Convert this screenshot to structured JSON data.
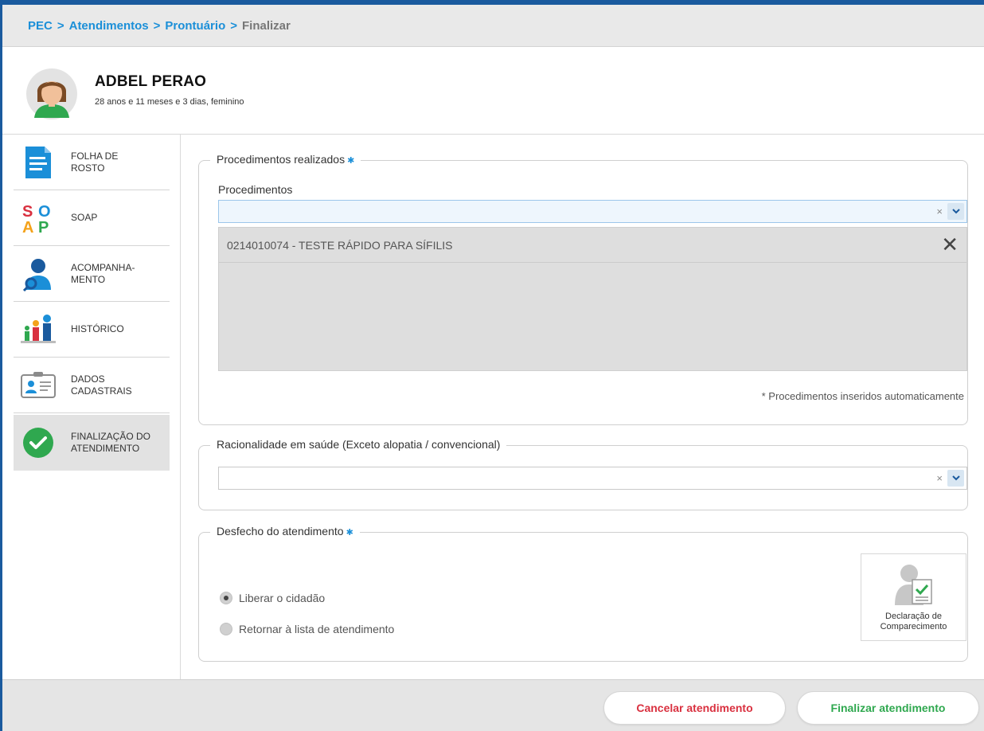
{
  "colors": {
    "brand_blue": "#1a5a9e",
    "link_blue": "#1b8fd8",
    "success_green": "#2fa84f",
    "danger_red": "#d9303f"
  },
  "breadcrumb": {
    "items": [
      "PEC",
      "Atendimentos",
      "Prontuário"
    ],
    "separator": ">",
    "current": "Finalizar"
  },
  "patient": {
    "name": "ADBEL PERAO",
    "info": "28 anos e 11 meses e 3 dias, feminino",
    "avatar_icon": "female-avatar-icon"
  },
  "sidebar": {
    "items": [
      {
        "label": "FOLHA DE\nROSTO",
        "icon": "document-icon"
      },
      {
        "label": "SOAP",
        "icon": "soap-icon",
        "icon_letters": [
          "S",
          "O",
          "A",
          "P"
        ]
      },
      {
        "label": "ACOMPANHA-\nMENTO",
        "icon": "user-search-icon"
      },
      {
        "label": "HISTÓRICO",
        "icon": "family-history-icon"
      },
      {
        "label": "DADOS\nCADASTRAIS",
        "icon": "id-card-icon"
      },
      {
        "label": "FINALIZAÇÃO DO\nATENDIMENTO",
        "icon": "check-circle-icon",
        "active": true
      }
    ]
  },
  "procedimentos": {
    "legend": "Procedimentos realizados",
    "required_mark": "✱",
    "field_label": "Procedimentos",
    "input_value": "",
    "clear_glyph": "×",
    "selected": [
      {
        "text": "0214010074 - TESTE RÁPIDO PARA SÍFILIS",
        "remove_glyph": "✕"
      }
    ],
    "note": "* Procedimentos inseridos automaticamente"
  },
  "racionalidade": {
    "legend": "Racionalidade em saúde (Exceto alopatia / convencional)",
    "input_value": "",
    "clear_glyph": "×"
  },
  "desfecho": {
    "legend": "Desfecho do atendimento",
    "required_mark": "✱",
    "options": [
      {
        "label": "Liberar o cidadão",
        "selected": true
      },
      {
        "label": "Retornar à lista de atendimento",
        "selected": false
      }
    ],
    "declaracao_label": "Declaração de\nComparecimento"
  },
  "footer": {
    "cancel_label": "Cancelar atendimento",
    "finish_label": "Finalizar atendimento"
  }
}
